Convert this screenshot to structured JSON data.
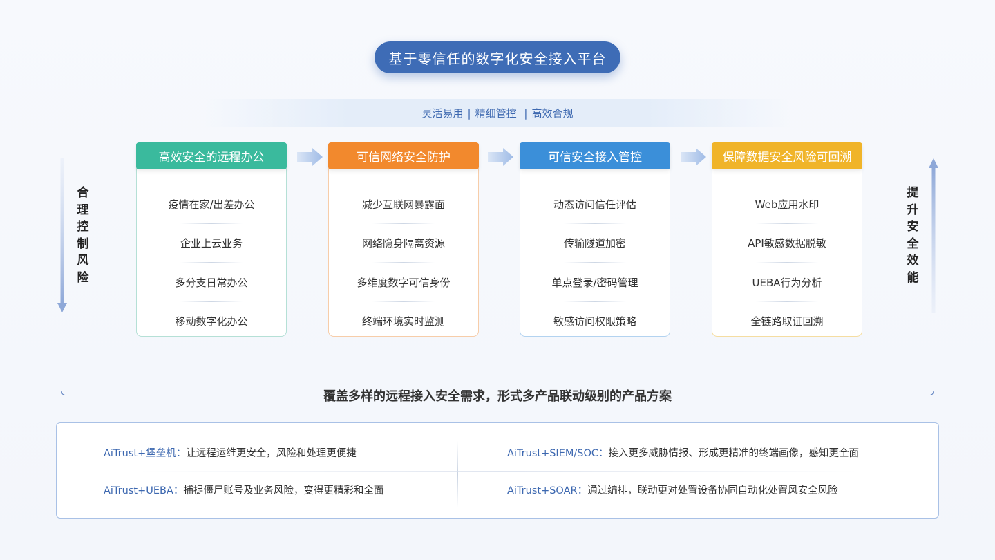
{
  "title": "基于零信任的数字化安全接入平台",
  "tagline": [
    "灵活易用",
    "精细管控",
    "高效合规"
  ],
  "left_label": [
    "合",
    "理",
    "控",
    "制",
    "风",
    "险"
  ],
  "right_label": [
    "提",
    "升",
    "安",
    "全",
    "效",
    "能"
  ],
  "colors": {
    "green": "#3aba9d",
    "orange": "#f2892d",
    "blue": "#3b8fd9",
    "yellow": "#f0b429",
    "accent": "#3e6cb6"
  },
  "columns": [
    {
      "header": "高效安全的远程办公",
      "items": [
        "疫情在家/出差办公",
        "企业上云业务",
        "多分支日常办公",
        "移动数字化办公"
      ]
    },
    {
      "header": "可信网络安全防护",
      "items": [
        "减少互联网暴露面",
        "网络隐身隔离资源",
        "多维度数字可信身份",
        "终端环境实时监测"
      ]
    },
    {
      "header": "可信安全接入管控",
      "items": [
        "动态访问信任评估",
        "传输隧道加密",
        "单点登录/密码管理",
        "敏感访问权限策略"
      ]
    },
    {
      "header": "保障数据安全风险可回溯",
      "items": [
        "Web应用水印",
        "API敏感数据脱敏",
        "UEBA行为分析",
        "全链路取证回溯"
      ]
    }
  ],
  "section_heading": "覆盖多样的远程接入安全需求，形式多产品联动级别的产品方案",
  "solutions": [
    {
      "product": "AiTrust+堡垒机：",
      "desc": "让远程运维更安全，风险和处理更便捷"
    },
    {
      "product": "AiTrust+SIEM/SOC：",
      "desc": "接入更多威胁情报、形成更精准的终端画像，感知更全面"
    },
    {
      "product": "AiTrust+UEBA：",
      "desc": "捕捉僵尸账号及业务风险，变得更精彩和全面"
    },
    {
      "product": "AiTrust+SOAR：",
      "desc": "通过编排，联动更对处置设备协同自动化处置风安全风险"
    }
  ]
}
